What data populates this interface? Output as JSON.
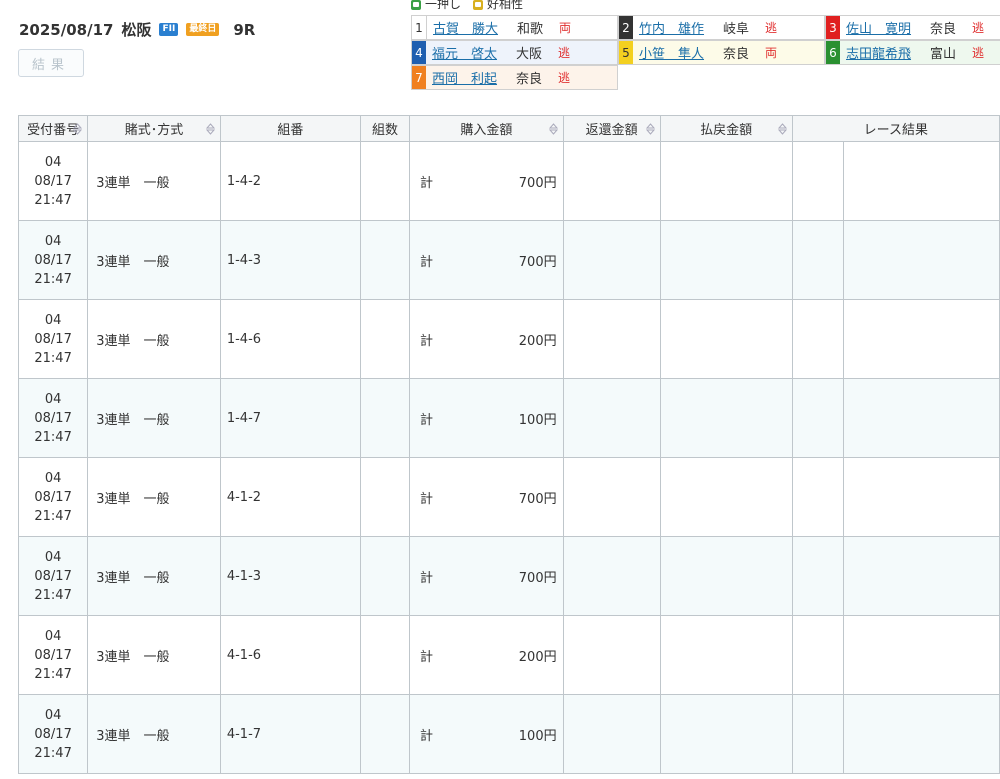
{
  "header": {
    "date": "2025/08/17",
    "venue": "松阪",
    "grade_badge": "FII",
    "day_badge": "最終日",
    "race": "9R",
    "result_button": "結果"
  },
  "legend": {
    "ichi_oshi": "一押し",
    "kou_aishou": "好相性",
    "colors": {
      "ichi_oshi": "#3aa045",
      "kou_aishou": "#d8b020"
    }
  },
  "racers": [
    {
      "num": "1",
      "name": "古賀　勝大",
      "pref": "和歌",
      "style": "両"
    },
    {
      "num": "2",
      "name": "竹内　雄作",
      "pref": "岐阜",
      "style": "逃"
    },
    {
      "num": "3",
      "name": "佐山　寛明",
      "pref": "奈良",
      "style": "逃"
    },
    {
      "num": "4",
      "name": "福元　啓太",
      "pref": "大阪",
      "style": "逃"
    },
    {
      "num": "5",
      "name": "小笹　隼人",
      "pref": "奈良",
      "style": "両"
    },
    {
      "num": "6",
      "name": "志田龍希飛",
      "pref": "富山",
      "style": "逃"
    },
    {
      "num": "7",
      "name": "西岡　利起",
      "pref": "奈良",
      "style": "逃"
    }
  ],
  "table": {
    "headers": [
      "受付番号",
      "賭式･方式",
      "組番",
      "組数",
      "購入金額",
      "返還金額",
      "払戻金額",
      "レース結果"
    ],
    "total_label": "計",
    "rows": [
      {
        "id": "04",
        "date": "08/17",
        "time": "21:47",
        "bet_type": "3連単　一般",
        "combo": "1-4-2",
        "count": "",
        "amount": "700円"
      },
      {
        "id": "04",
        "date": "08/17",
        "time": "21:47",
        "bet_type": "3連単　一般",
        "combo": "1-4-3",
        "count": "",
        "amount": "700円"
      },
      {
        "id": "04",
        "date": "08/17",
        "time": "21:47",
        "bet_type": "3連単　一般",
        "combo": "1-4-6",
        "count": "",
        "amount": "200円"
      },
      {
        "id": "04",
        "date": "08/17",
        "time": "21:47",
        "bet_type": "3連単　一般",
        "combo": "1-4-7",
        "count": "",
        "amount": "100円"
      },
      {
        "id": "04",
        "date": "08/17",
        "time": "21:47",
        "bet_type": "3連単　一般",
        "combo": "4-1-2",
        "count": "",
        "amount": "700円"
      },
      {
        "id": "04",
        "date": "08/17",
        "time": "21:47",
        "bet_type": "3連単　一般",
        "combo": "4-1-3",
        "count": "",
        "amount": "700円"
      },
      {
        "id": "04",
        "date": "08/17",
        "time": "21:47",
        "bet_type": "3連単　一般",
        "combo": "4-1-6",
        "count": "",
        "amount": "200円"
      },
      {
        "id": "04",
        "date": "08/17",
        "time": "21:47",
        "bet_type": "3連単　一般",
        "combo": "4-1-7",
        "count": "",
        "amount": "100円"
      }
    ]
  }
}
